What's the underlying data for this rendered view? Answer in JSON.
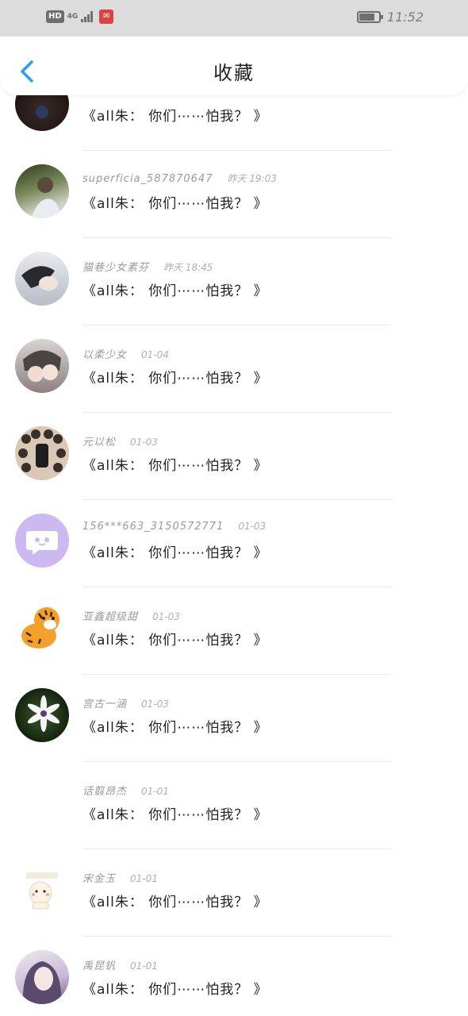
{
  "status_bar": {
    "hd": "HD",
    "network": "4G",
    "time": "11:52",
    "battery_level": 0.75
  },
  "header": {
    "back_icon": "chevron-left-icon",
    "title": "收藏"
  },
  "accent_color": "#2a9df4",
  "items": [
    {
      "username": "",
      "time": "",
      "title": "《all朱： 你们⋯⋯怕我？ 》",
      "avatar": "photo-dark"
    },
    {
      "username": "superficia_587870647",
      "time": "昨天 19:03",
      "title": "《all朱： 你们⋯⋯怕我？ 》",
      "avatar": "photo-person"
    },
    {
      "username": "猫巷少女素芬",
      "time": "昨天 18:45",
      "title": "《all朱： 你们⋯⋯怕我？ 》",
      "avatar": "photo-girl"
    },
    {
      "username": "以柔少女",
      "time": "01-04",
      "title": "《all朱： 你们⋯⋯怕我？ 》",
      "avatar": "anime"
    },
    {
      "username": "元以松",
      "time": "01-03",
      "title": "《all朱： 你们⋯⋯怕我？ 》",
      "avatar": "group-photo"
    },
    {
      "username": "156***663_3150572771",
      "time": "01-03",
      "title": "《all朱： 你们⋯⋯怕我？ 》",
      "avatar": "default-chat-bubble"
    },
    {
      "username": "亚鑫超级甜",
      "time": "01-03",
      "title": "《all朱： 你们⋯⋯怕我？ 》",
      "avatar": "tiger"
    },
    {
      "username": "宫古一涵",
      "time": "01-03",
      "title": "《all朱： 你们⋯⋯怕我？ 》",
      "avatar": "flower"
    },
    {
      "username": "话翦昂杰",
      "time": "01-01",
      "title": "《all朱： 你们⋯⋯怕我？ 》",
      "avatar": "none"
    },
    {
      "username": "宋金玉",
      "time": "01-01",
      "title": "《all朱： 你们⋯⋯怕我？ 》",
      "avatar": "cartoon-sticker"
    },
    {
      "username": "禹昆钒",
      "time": "01-01",
      "title": "《all朱： 你们⋯⋯怕我？ 》",
      "avatar": "photo-purple-hair"
    }
  ]
}
